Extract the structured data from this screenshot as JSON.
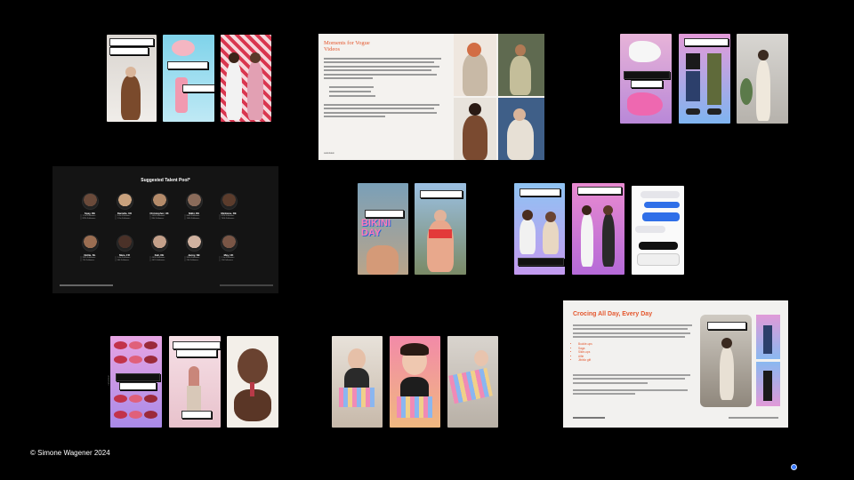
{
  "footer": {
    "copyright": "© Simone Wagener 2024"
  },
  "slide_mfv": {
    "title_line1": "Moments for Vogue",
    "title_line2": "Videos",
    "footer_left": "calvinklein"
  },
  "slide_talent": {
    "title": "Suggested Talent Pool*",
    "talents": [
      {
        "name": "Spay, DE",
        "stat1": "1.2m Followers",
        "stat2": "825k Followers",
        "color": "#6a4a3a"
      },
      {
        "name": "Danielle, UK",
        "stat1": "3.4m Followers",
        "stat2": "1.2m Followers",
        "color": "#c9a27e"
      },
      {
        "name": "Christopher, UK",
        "stat1": "445k Followers",
        "stat2": "80k Followers",
        "color": "#b48b6a"
      },
      {
        "name": "Nikki, DE",
        "stat1": "864k Followers",
        "stat2": "144k Followers",
        "color": "#8a6b5a"
      },
      {
        "name": "Mickiane, DE",
        "stat1": "620k Followers",
        "stat2": "740k Followers",
        "color": "#5b3c2c"
      },
      {
        "name": "Nolite, NL",
        "stat1": "282k Followers",
        "stat2": "71k Followers",
        "color": "#9b6e52"
      },
      {
        "name": "Mare, FR",
        "stat1": "1.4m Followers",
        "stat2": "56k Followers",
        "color": "#4a3128"
      },
      {
        "name": "Kali, DE",
        "stat1": "460k Followers",
        "stat2": "467k Followers",
        "color": "#c4a08a"
      },
      {
        "name": "Jenny, NE",
        "stat1": "960k Followers",
        "stat2": "25k Followers",
        "color": "#d0b2a0"
      },
      {
        "name": "May, UK",
        "stat1": "1.1m Followers",
        "stat2": "11k Followers",
        "color": "#7a5646"
      }
    ]
  },
  "slide_crocs": {
    "title": "Crocing All Day, Every Day",
    "bullets": [
      "Buckle-ups",
      "Saga",
      "Slide-ups",
      "Alfie",
      "Jibbitz gift"
    ]
  },
  "stories": {
    "bikini_text": "BIKINI DAY"
  }
}
